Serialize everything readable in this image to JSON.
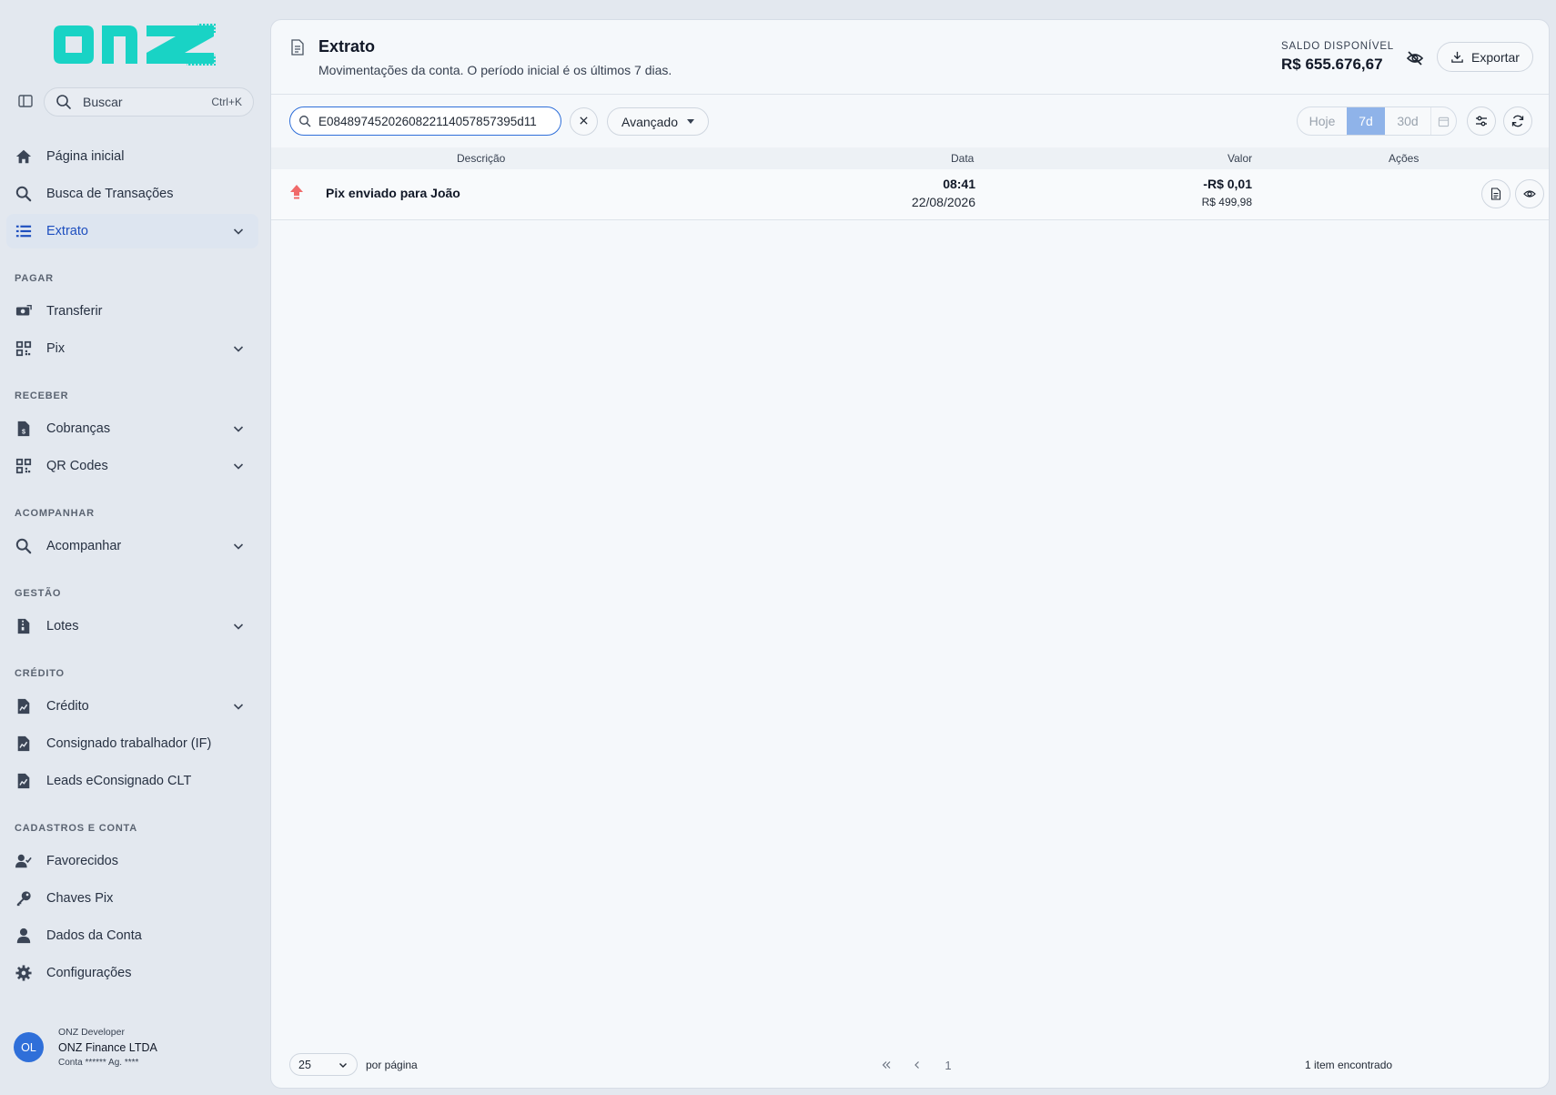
{
  "brand": {
    "logo_text": "onz",
    "accent": "#19d3c5"
  },
  "sidebar": {
    "search_placeholder": "Buscar",
    "search_shortcut": "Ctrl+K",
    "items": {
      "home": "Página inicial",
      "busca": "Busca de Transações",
      "extrato": "Extrato",
      "transferir": "Transferir",
      "pix": "Pix",
      "cobrancas": "Cobranças",
      "qrcodes": "QR Codes",
      "acompanhar": "Acompanhar",
      "lotes": "Lotes",
      "credito": "Crédito",
      "consignado": "Consignado trabalhador (IF)",
      "leads": "Leads eConsignado CLT",
      "favorecidos": "Favorecidos",
      "chaves": "Chaves Pix",
      "dados": "Dados da Conta",
      "config": "Configurações"
    },
    "sections": {
      "pagar": "PAGAR",
      "receber": "RECEBER",
      "acompanhar": "ACOMPANHAR",
      "gestao": "GESTÃO",
      "credito": "CRÉDITO",
      "cadastros": "CADASTROS E CONTA"
    },
    "active": "Extrato"
  },
  "user": {
    "initials": "OL",
    "role": "ONZ Developer",
    "company": "ONZ Finance LTDA",
    "account": "Conta ****** Ag. ****"
  },
  "header": {
    "title": "Extrato",
    "subtitle": "Movimentações da conta. O período inicial é os últimos 7 dias.",
    "balance_label": "SALDO DISPONÍVEL",
    "balance_value": "R$ 655.676,67",
    "export_label": "Exportar"
  },
  "filters": {
    "search_value": "E0848974520260822114057857395d11",
    "advanced_label": "Avançado",
    "period_options": [
      "Hoje",
      "7d",
      "30d"
    ],
    "period_selected": "7d"
  },
  "table": {
    "columns": {
      "descricao": "Descrição",
      "data": "Data",
      "valor": "Valor",
      "acoes": "Ações"
    },
    "rows": [
      {
        "description": "Pix enviado para João",
        "time": "08:41",
        "date": "22/08/2026",
        "amount": "-R$ 0,01",
        "balance": "R$ 499,98",
        "direction": "out",
        "direction_color": "#f06a6a"
      }
    ]
  },
  "footer": {
    "per_page_value": "25",
    "per_page_label": "por página",
    "current_page": "1",
    "found_label": "1 item encontrado"
  }
}
